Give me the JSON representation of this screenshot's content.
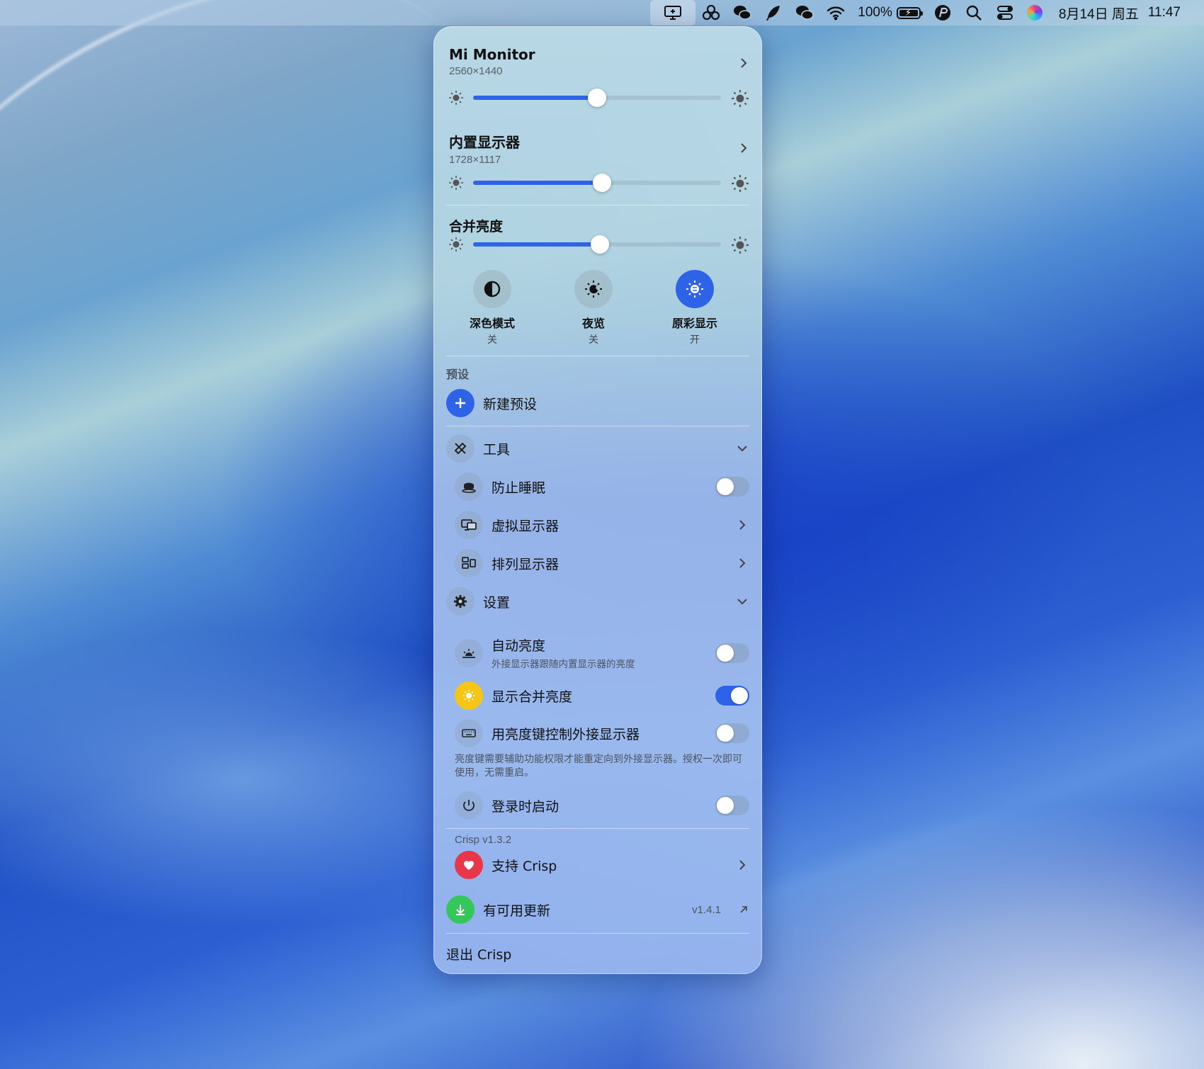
{
  "menubar": {
    "battery_percent": "100%",
    "date": "8月14日 周五",
    "time": "11:47",
    "icons": [
      "crisp-display-icon",
      "cluster-icon",
      "wechat-icon",
      "feather-icon",
      "wechat-icon",
      "wifi-icon",
      "battery-icon",
      "pixelmator-icon",
      "search-icon",
      "control-center-icon",
      "siri-icon"
    ]
  },
  "displays": [
    {
      "name": "Mi Monitor",
      "resolution": "2560×1440",
      "brightness": 0.5
    },
    {
      "name": "内置显示器",
      "resolution": "1728×1117",
      "brightness": 0.52
    }
  ],
  "combined": {
    "label": "合并亮度",
    "brightness": 0.51
  },
  "modes": [
    {
      "label": "深色模式",
      "state": "关",
      "on": false,
      "icon": "half-circle-icon"
    },
    {
      "label": "夜览",
      "state": "关",
      "on": false,
      "icon": "night-sun-icon"
    },
    {
      "label": "原彩显示",
      "state": "开",
      "on": true,
      "icon": "true-tone-icon"
    }
  ],
  "presets": {
    "heading": "预设",
    "new_label": "新建预设"
  },
  "tools": {
    "label": "工具",
    "items": [
      {
        "label": "防止睡眠",
        "type": "toggle",
        "on": false
      },
      {
        "label": "虚拟显示器",
        "type": "chevron"
      },
      {
        "label": "排列显示器",
        "type": "chevron"
      }
    ]
  },
  "settings": {
    "label": "设置",
    "auto_brightness": {
      "label": "自动亮度",
      "sub": "外接显示器跟随内置显示器的亮度",
      "on": false
    },
    "show_combined": {
      "label": "显示合并亮度",
      "on": true
    },
    "brightness_keys": {
      "label": "用亮度键控制外接显示器",
      "on": false
    },
    "note": "亮度键需要辅助功能权限才能重定向到外接显示器。授权一次即可使用，无需重启。",
    "login": {
      "label": "登录时启动",
      "on": false
    }
  },
  "footer": {
    "version": "Crisp v1.3.2",
    "support": "支持 Crisp",
    "update": "有可用更新",
    "update_version": "v1.4.1",
    "quit": "退出 Crisp"
  },
  "colors": {
    "accent": "#2e63e8",
    "heart": "#e8364a",
    "update": "#34c759",
    "sun_yellow": "#f5c518"
  }
}
